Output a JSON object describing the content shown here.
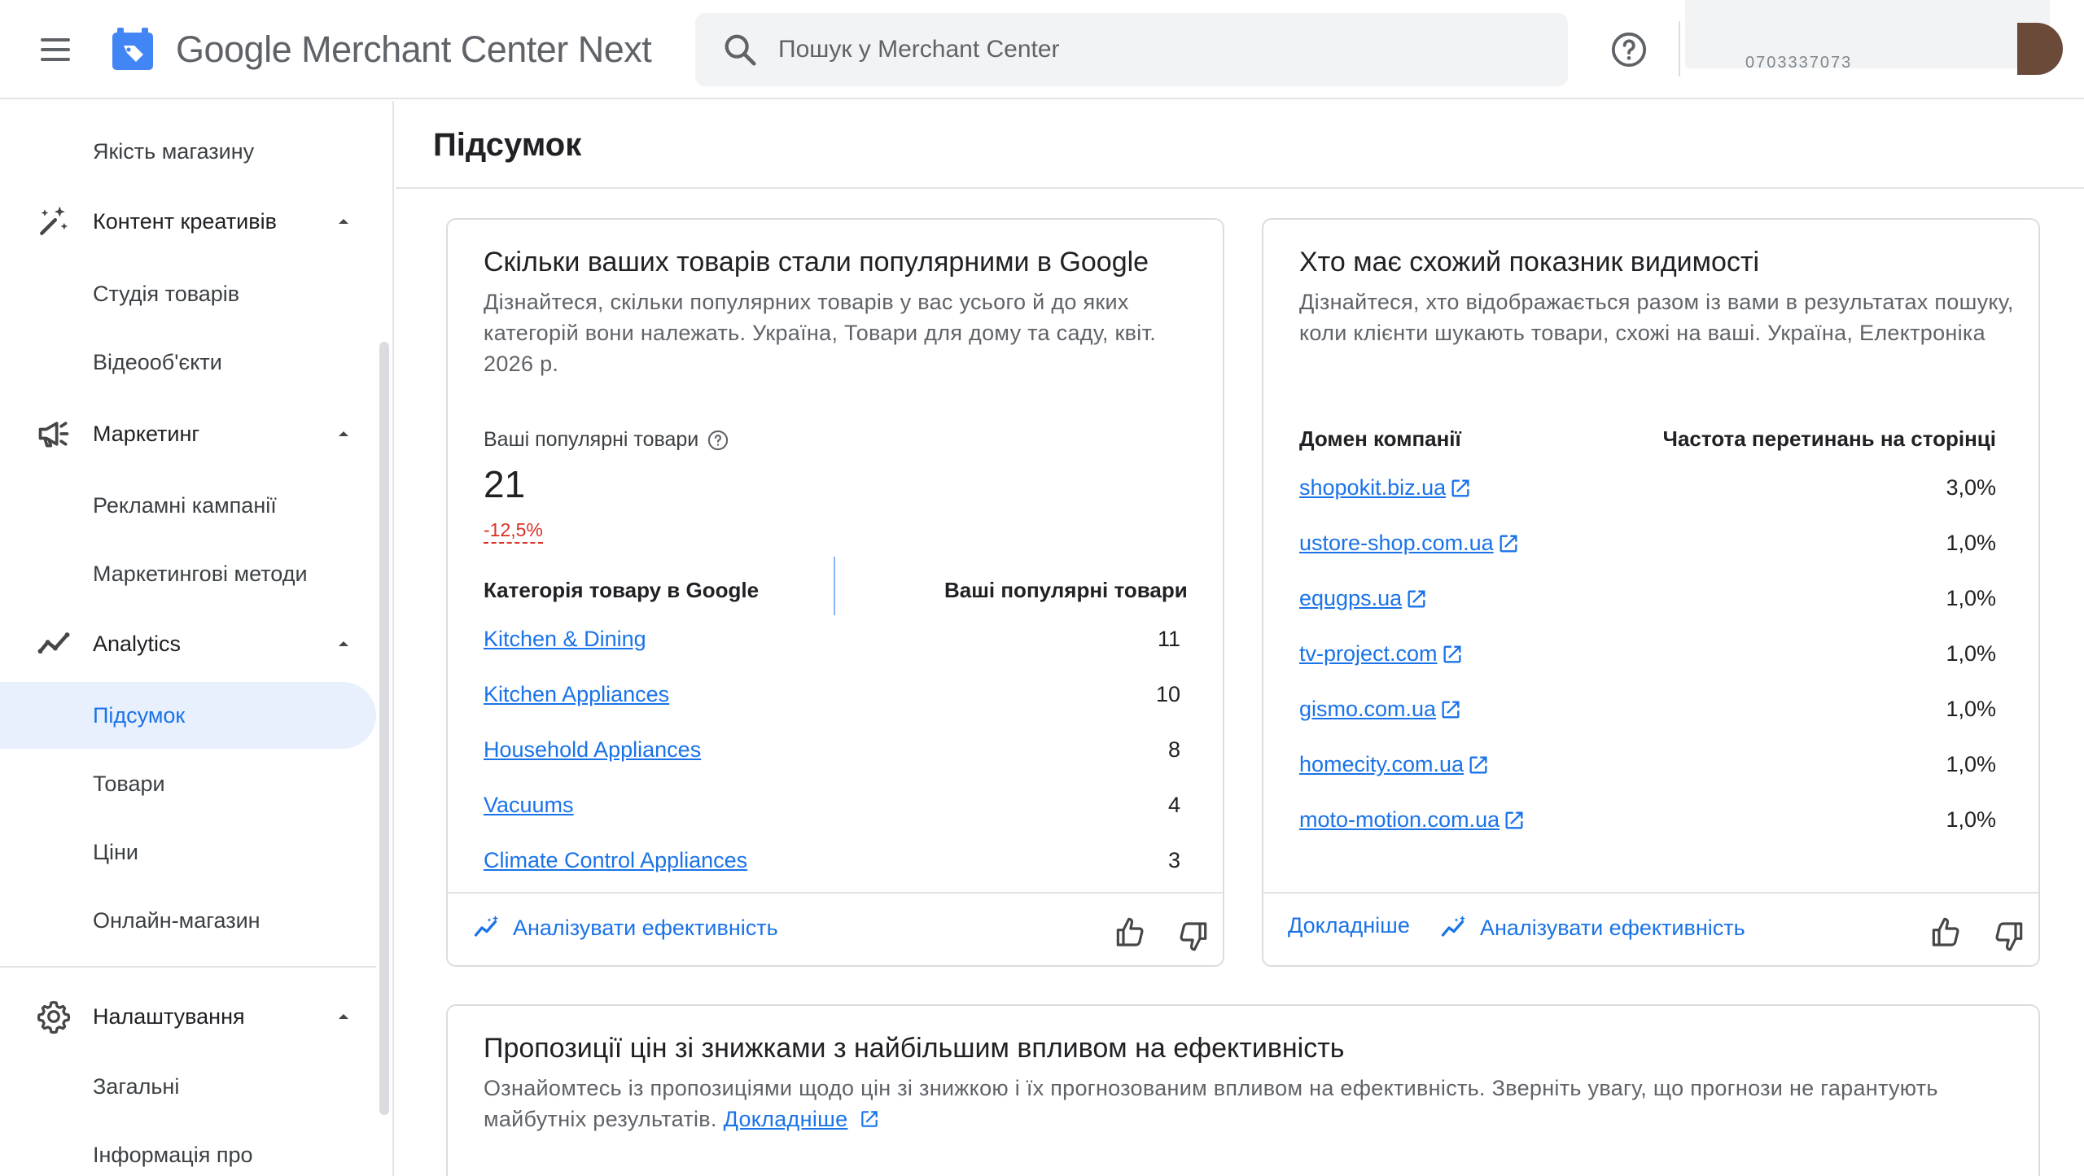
{
  "header": {
    "app_name": "Google Merchant Center Next",
    "search_placeholder": "Пошук у Merchant Center",
    "account_id": "0703337073"
  },
  "sidebar": {
    "items": [
      {
        "label": "Якість магазину",
        "type": "sub"
      },
      {
        "label": "Контент креативів",
        "type": "group",
        "icon": "magic-wand-icon"
      },
      {
        "label": "Студія товарів",
        "type": "sub"
      },
      {
        "label": "Відеооб'єкти",
        "type": "sub"
      },
      {
        "label": "Маркетинг",
        "type": "group",
        "icon": "megaphone-icon"
      },
      {
        "label": "Рекламні кампанії",
        "type": "sub"
      },
      {
        "label": "Маркетингові методи",
        "type": "sub"
      },
      {
        "label": "Analytics",
        "type": "group",
        "icon": "analytics-trend-icon"
      },
      {
        "label": "Підсумок",
        "type": "sub",
        "active": true
      },
      {
        "label": "Товари",
        "type": "sub"
      },
      {
        "label": "Ціни",
        "type": "sub"
      },
      {
        "label": "Онлайн-магазин",
        "type": "sub"
      },
      {
        "label": "Налаштування",
        "type": "group",
        "icon": "gear-icon"
      },
      {
        "label": "Загальні",
        "type": "sub"
      },
      {
        "label": "Інформація про",
        "type": "sub"
      }
    ]
  },
  "main": {
    "title": "Підсумок",
    "popular_card": {
      "title": "Скільки ваших товарів стали популярними в Google",
      "description": "Дізнайтеся, скільки популярних товарів у вас усього й до яких категорій вони належать. Україна, Товари для дому та саду, квіт. 2026 р.",
      "metric_label": "Ваші популярні товари",
      "metric_value": "21",
      "metric_delta": "-12,5%",
      "col_category": "Категорія товару в Google",
      "col_count": "Ваші популярні товари",
      "rows": [
        {
          "category": "Kitchen & Dining",
          "count": "11"
        },
        {
          "category": "Kitchen Appliances",
          "count": "10"
        },
        {
          "category": "Household Appliances",
          "count": "8"
        },
        {
          "category": "Vacuums",
          "count": "4"
        },
        {
          "category": "Climate Control Appliances",
          "count": "3"
        }
      ],
      "analyze_label": "Аналізувати ефективність"
    },
    "visibility_card": {
      "title": "Хто має схожий показник видимості",
      "description": "Дізнайтеся, хто відображається разом із вами в результатах пошуку, коли клієнти шукають товари, схожі на ваші. Україна, Електроніка",
      "col_domain": "Домен компанії",
      "col_overlap": "Частота перетинань на сторінці",
      "rows": [
        {
          "domain": "shopokit.biz.ua",
          "overlap": "3,0%"
        },
        {
          "domain": "ustore-shop.com.ua",
          "overlap": "1,0%"
        },
        {
          "domain": "equgps.ua",
          "overlap": "1,0%"
        },
        {
          "domain": "tv-project.com",
          "overlap": "1,0%"
        },
        {
          "domain": "gismo.com.ua",
          "overlap": "1,0%"
        },
        {
          "domain": "homecity.com.ua",
          "overlap": "1,0%"
        },
        {
          "domain": "moto-motion.com.ua",
          "overlap": "1,0%"
        }
      ],
      "details_label": "Докладніше",
      "analyze_label": "Аналізувати ефективність"
    },
    "discount_card": {
      "title": "Пропозиції цін зі знижками з найбільшим впливом на ефективність",
      "description": "Ознайомтесь із пропозиціями щодо цін зі знижкою і їх прогнозованим впливом на ефективність. Зверніть увагу, що прогнози не гарантують майбутніх результатів.",
      "details_link": "Докладніше"
    }
  },
  "colors": {
    "accent": "#1a73e8",
    "active_nav_bg": "#e8f0fe",
    "negative": "#d93025"
  }
}
